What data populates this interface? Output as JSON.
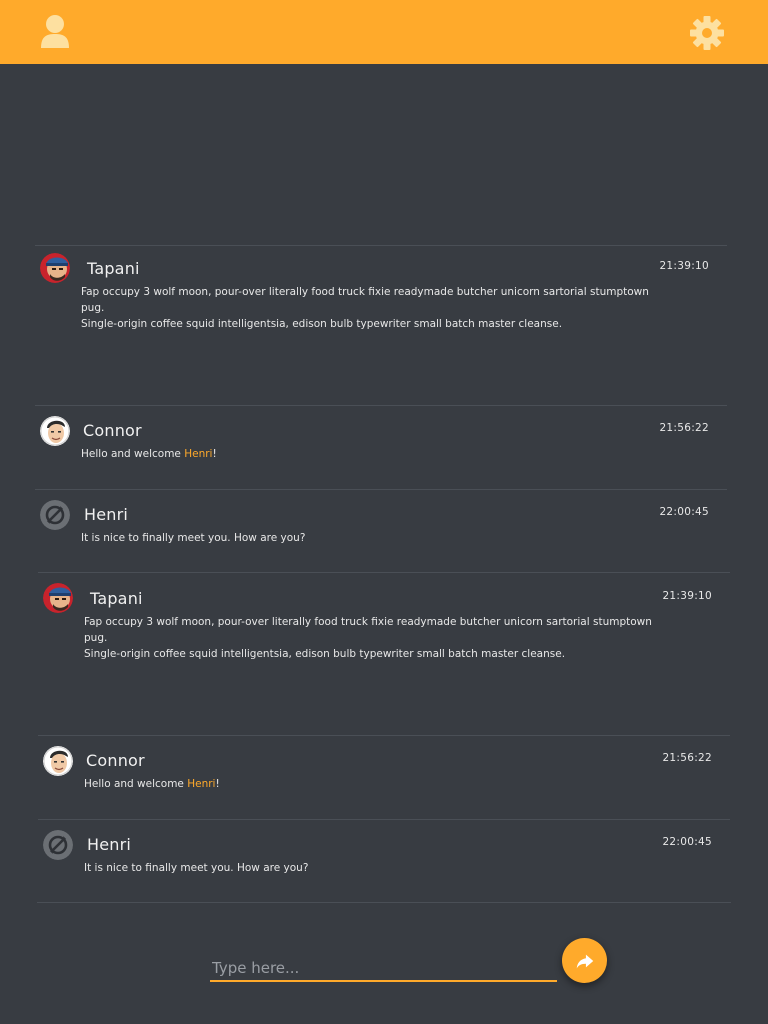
{
  "header": {
    "user_icon": "user-icon",
    "settings_icon": "gear-icon",
    "accent_color": "#ffaa2b"
  },
  "messages": [
    {
      "name": "Tapani",
      "time": "21:39:10",
      "avatar": "tapani-avatar",
      "text_line1": "Fap occupy 3 wolf moon, pour-over literally food truck fixie readymade butcher unicorn sartorial stumptown pug.",
      "text_line2": "Single-origin coffee squid intelligentsia, edison bulb typewriter small batch master cleanse."
    },
    {
      "name": "Connor",
      "time": "21:56:22",
      "avatar": "connor-avatar",
      "text_before": "Hello and welcome ",
      "mention": "Henri",
      "text_after": "!"
    },
    {
      "name": "Henri",
      "time": "22:00:45",
      "avatar": "henri-avatar",
      "text": "It is nice to finally meet you. How are you?"
    },
    {
      "name": "Tapani",
      "time": "21:39:10",
      "avatar": "tapani-avatar",
      "text_line1": "Fap occupy 3 wolf moon, pour-over literally food truck fixie readymade butcher unicorn sartorial stumptown pug.",
      "text_line2": "Single-origin coffee squid intelligentsia, edison bulb typewriter small batch master cleanse."
    },
    {
      "name": "Connor",
      "time": "21:56:22",
      "avatar": "connor-avatar",
      "text_before": "Hello and welcome ",
      "mention": "Henri",
      "text_after": "!"
    },
    {
      "name": "Henri",
      "time": "22:00:45",
      "avatar": "henri-avatar",
      "text": "It is nice to finally meet you. How are you?"
    }
  ],
  "composer": {
    "placeholder": "Type here...",
    "value": "",
    "send_icon": "share-arrow-icon"
  }
}
